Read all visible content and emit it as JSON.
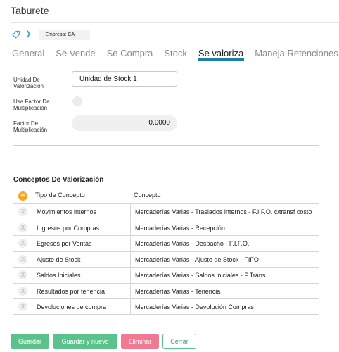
{
  "header": {
    "title": "Taburete"
  },
  "tags": {
    "empresa": "Empresa: CA"
  },
  "tabs": [
    {
      "label": "General"
    },
    {
      "label": "Se Vende"
    },
    {
      "label": "Se Compra"
    },
    {
      "label": "Stock"
    },
    {
      "label": "Se valoriza",
      "active": true
    },
    {
      "label": "Maneja Retenciones"
    }
  ],
  "form": {
    "unidad_label": "Unidad De Valorizacion",
    "unidad_value": "Unidad de Stock 1",
    "usa_factor_label": "Usa Factor De Multiplicación",
    "usa_factor_checked": false,
    "factor_label": "Factor De Multiplicación",
    "factor_value": "0.0000"
  },
  "conceptos": {
    "title": "Conceptos De Valorización",
    "col_tipo": "Tipo de Concepto",
    "col_concepto": "Concepto",
    "rows": [
      {
        "tipo": "Movimientos internos",
        "concepto": "Mercaderías Varias - Traslados internos - F.I.F.O. c/transf costo"
      },
      {
        "tipo": "Ingresos por Compras",
        "concepto": "Mercaderías Varias - Recepción"
      },
      {
        "tipo": "Egresos por Ventas",
        "concepto": "Mercaderías Varias - Despacho - F.I.F.O."
      },
      {
        "tipo": "Ajuste de Stock",
        "concepto": "Mercaderías Varias - Ajuste de Stock - FIFO"
      },
      {
        "tipo": "Saldos Iniciales",
        "concepto": "Mercaderías Varias - Saldos iniciales - P.Trans"
      },
      {
        "tipo": "Resultados por tenencia",
        "concepto": "Mercaderías Varias - Tenencia"
      },
      {
        "tipo": "Devoluciones de compra",
        "concepto": "Mercaderías Varias - Devolución Compras"
      }
    ]
  },
  "actions": {
    "guardar": "Guardar",
    "guardar_nuevo": "Guardar y nuevo",
    "eliminar": "Eliminar",
    "cerrar": "Cerrar"
  },
  "icons": {
    "tag": "tag-icon",
    "chevron": "chevron-right-icon",
    "add": "plus-circle-icon",
    "remove": "x-circle-icon"
  },
  "colors": {
    "accent": "#1d7fa8",
    "green": "#5bc28c",
    "red": "#ef7a92",
    "orange": "#f5a623"
  }
}
